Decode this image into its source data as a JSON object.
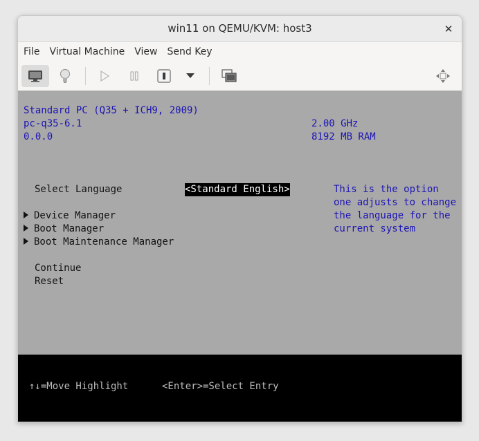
{
  "window": {
    "title": "win11 on QEMU/KVM: host3"
  },
  "menu": {
    "file": "File",
    "virtual_machine": "Virtual Machine",
    "view": "View",
    "send_key": "Send Key"
  },
  "toolbar": {
    "icons": [
      "monitor-icon",
      "lightbulb-icon",
      "play-icon",
      "pause-icon",
      "power-icon",
      "chevron-down-icon",
      "screenshot-icon",
      "move-icon"
    ]
  },
  "bios": {
    "platform": "Standard PC (Q35 + ICH9, 2009)",
    "version": "pc-q35-6.1",
    "build": "0.0.0",
    "cpu": "2.00 GHz",
    "ram": "8192 MB RAM",
    "select_language_label": "Select Language",
    "language_value": "<Standard English>",
    "help_lines": [
      "This is the option",
      "one adjusts to change",
      "the language for the",
      "current system"
    ],
    "menu_items": [
      "Device Manager",
      "Boot Manager",
      "Boot Maintenance Manager"
    ],
    "continue": "Continue",
    "reset": "Reset",
    "footer_move": "↑↓=Move Highlight",
    "footer_enter": "<Enter>=Select Entry"
  },
  "colors": {
    "screen_bg": "#a9a9a9",
    "bios_blue": "#1c14b4",
    "footer_bg": "#000000"
  }
}
